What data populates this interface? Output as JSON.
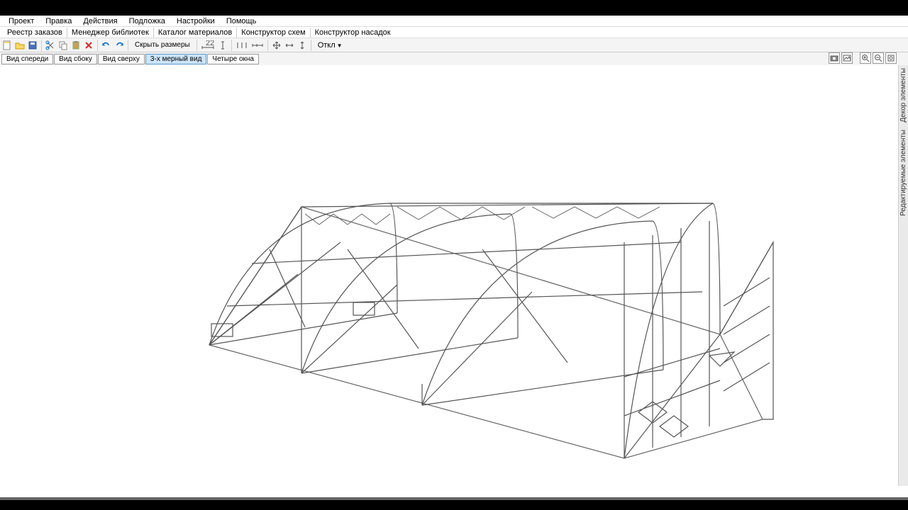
{
  "menu": {
    "items": [
      "Проект",
      "Правка",
      "Действия",
      "Подложка",
      "Настройки",
      "Помощь"
    ]
  },
  "submenu": {
    "items": [
      "Реестр заказов",
      "Менеджер библиотек",
      "Каталог материалов",
      "Конструктор схем",
      "Конструктор насадок"
    ]
  },
  "toolbar": {
    "hide_dims": "Скрыть размеры",
    "deviation": "Откл"
  },
  "view_tabs": {
    "items": [
      "Вид спереди",
      "Вид сбоку",
      "Вид сверху",
      "3-х мерный вид",
      "Четыре окна"
    ],
    "active_index": 3
  },
  "right_panel": {
    "label1": "Декор элементы",
    "label2": "Редактируемые элементы"
  },
  "icons": {
    "new": "new-file-icon",
    "open": "open-folder-icon",
    "save": "save-icon",
    "cut": "cut-icon",
    "copy": "copy-icon",
    "paste": "paste-icon",
    "delete": "delete-icon",
    "undo": "undo-icon",
    "redo": "redo-icon",
    "dim1": "dimension-icon",
    "dim2": "dimension-vertical-icon",
    "dim3": "dimension-spacing-icon",
    "dim4": "dimension-chain-icon",
    "move": "move-icon",
    "resize-h": "resize-horizontal-icon",
    "resize-v": "resize-vertical-icon",
    "camera": "camera-icon",
    "photo": "photo-icon",
    "zoom-in": "zoom-in-icon",
    "zoom-out": "zoom-out-icon",
    "zoom-fit": "zoom-fit-icon"
  }
}
